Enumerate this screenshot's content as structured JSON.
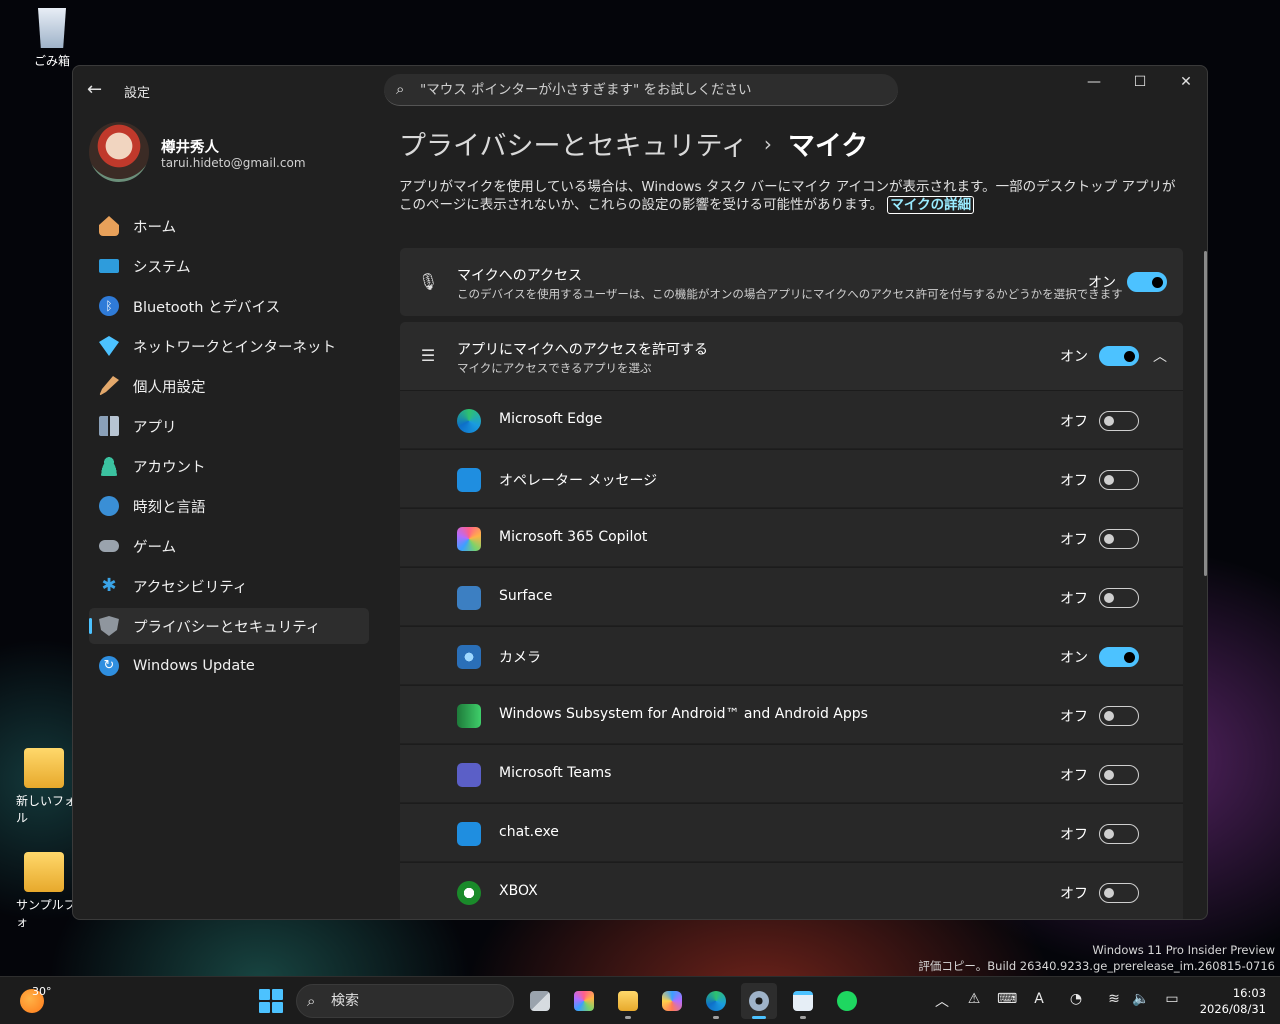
{
  "desktop": {
    "icons": [
      {
        "label": "ごみ箱"
      },
      {
        "label": "新しいフォル"
      },
      {
        "label": "サンプルフォ"
      }
    ],
    "build_line1": "Windows 11 Pro Insider Preview",
    "build_line2": "評価コピー。Build 26340.9233.ge_prerelease_im.260815-0716"
  },
  "window": {
    "app_title": "設定",
    "search_placeholder": "\"マウス ポインターが小さすぎます\" をお試しください",
    "profile": {
      "name": "樽井秀人",
      "email": "tarui.hideto@gmail.com"
    },
    "nav": [
      {
        "label": "ホーム",
        "icon": "home-icon",
        "color": "#e8a15a"
      },
      {
        "label": "システム",
        "icon": "system-icon",
        "color": "#2e9cdc"
      },
      {
        "label": "Bluetooth とデバイス",
        "icon": "bluetooth-icon",
        "color": "#2f7bd8"
      },
      {
        "label": "ネットワークとインターネット",
        "icon": "network-icon",
        "color": "#4cc2ff"
      },
      {
        "label": "個人用設定",
        "icon": "brush-icon",
        "color": "#e3a86b"
      },
      {
        "label": "アプリ",
        "icon": "apps-icon",
        "color": "#8aa0b8"
      },
      {
        "label": "アカウント",
        "icon": "account-icon",
        "color": "#3bc2a0"
      },
      {
        "label": "時刻と言語",
        "icon": "clock-globe-icon",
        "color": "#3a8fd6"
      },
      {
        "label": "ゲーム",
        "icon": "gamepad-icon",
        "color": "#9aa3ad"
      },
      {
        "label": "アクセシビリティ",
        "icon": "accessibility-icon",
        "color": "#3aa3e6"
      },
      {
        "label": "プライバシーとセキュリティ",
        "icon": "shield-icon",
        "color": "#8f969e"
      },
      {
        "label": "Windows Update",
        "icon": "update-icon",
        "color": "#2f8fe0"
      }
    ],
    "breadcrumb": {
      "parent": "プライバシーとセキュリティ",
      "separator": "›",
      "current": "マイク"
    },
    "description": "アプリがマイクを使用している場合は、Windows タスク バーにマイク アイコンが表示されます。一部のデスクトップ アプリがこのページに表示されないか、これらの設定の影響を受ける可能性があります。",
    "description_link": "マイクの詳細",
    "mic_access": {
      "title": "マイクへのアクセス",
      "subtitle": "このデバイスを使用するユーザーは、この機能がオンの場合アプリにマイクへのアクセス許可を付与するかどうかを選択できます",
      "state": "オン",
      "on": true
    },
    "apps_access": {
      "title": "アプリにマイクへのアクセスを許可する",
      "subtitle": "マイクにアクセスできるアプリを選ぶ",
      "state": "オン",
      "on": true
    },
    "apps": [
      {
        "name": "Microsoft Edge",
        "state": "オフ",
        "on": false,
        "icon": "edge-icon"
      },
      {
        "name": "オペレーター メッセージ",
        "state": "オフ",
        "on": false,
        "icon": "operator-message-icon"
      },
      {
        "name": "Microsoft 365 Copilot",
        "state": "オフ",
        "on": false,
        "icon": "m365-copilot-icon"
      },
      {
        "name": "Surface",
        "state": "オフ",
        "on": false,
        "icon": "surface-icon"
      },
      {
        "name": "カメラ",
        "state": "オン",
        "on": true,
        "icon": "camera-icon"
      },
      {
        "name": "Windows Subsystem for Android™ and Android Apps",
        "state": "オフ",
        "on": false,
        "icon": "wsa-icon"
      },
      {
        "name": "Microsoft Teams",
        "state": "オフ",
        "on": false,
        "icon": "teams-icon"
      },
      {
        "name": "chat.exe",
        "state": "オフ",
        "on": false,
        "icon": "chat-icon"
      },
      {
        "name": "XBOX",
        "state": "オフ",
        "on": false,
        "icon": "xbox-icon"
      }
    ]
  },
  "taskbar": {
    "weather_temp": "30°",
    "search_placeholder": "検索",
    "time": "16:03",
    "date": "2026/08/31"
  }
}
